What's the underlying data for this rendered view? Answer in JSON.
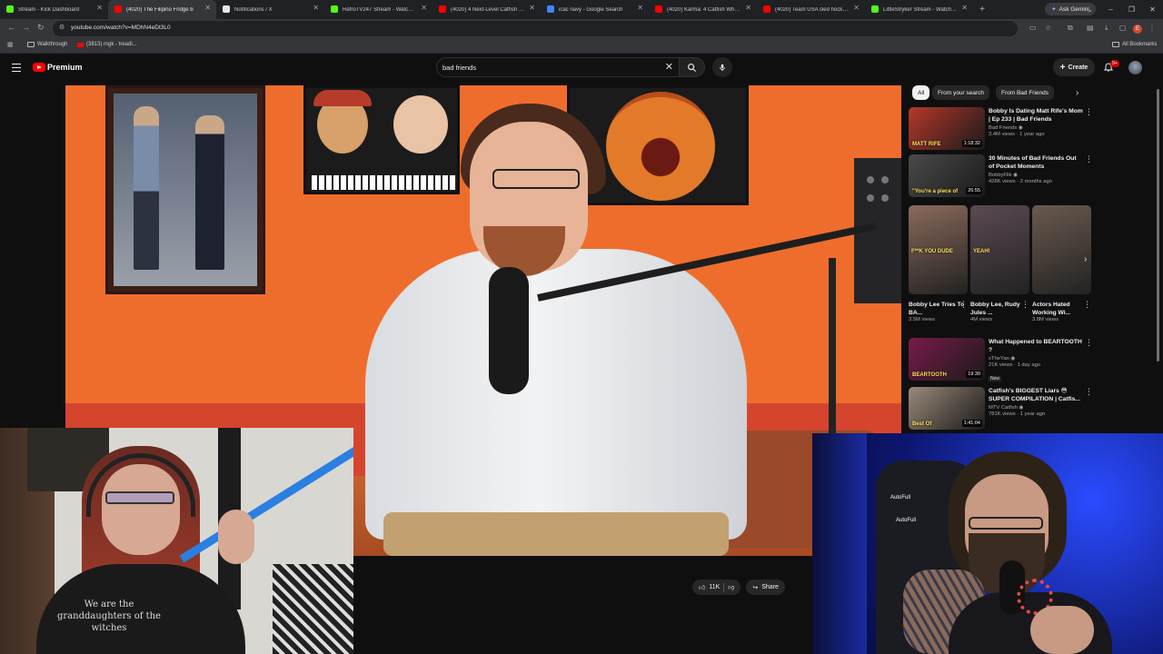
{
  "browser": {
    "tabs": [
      {
        "title": "Stream - Kick Dashboard",
        "favicon_color": "#53fc18",
        "active": false
      },
      {
        "title": "(4020) The Filipino Fridge b",
        "favicon_color": "#ff0000",
        "active": true
      },
      {
        "title": "Notifications / X",
        "favicon_color": "#e8e8e8",
        "active": false
      },
      {
        "title": "RetroTV247 Stream - Watch Li",
        "favicon_color": "#53fc18",
        "active": false
      },
      {
        "title": "(4020) 4 Next-Level Catfish Inv",
        "favicon_color": "#ff0000",
        "active": false
      },
      {
        "title": "icac navy - Google Search",
        "favicon_color": "#4285f4",
        "active": false
      },
      {
        "title": "(4020) Karma: 4 Catfish Who G",
        "favicon_color": "#ff0000",
        "active": false
      },
      {
        "title": "(4020) Team USA sled hockey o",
        "favicon_color": "#ff0000",
        "active": false
      },
      {
        "title": "LittleStryker Stream - Watch Li",
        "favicon_color": "#53fc18",
        "active": false
      }
    ],
    "new_tab": "+",
    "ask_gemini": "Ask Gemini",
    "address": "youtube.com/watch?v=MDhN4eDt3L0",
    "profile_initial": "E",
    "bookmarks": [
      {
        "label": "Walkthrough",
        "icon": "folder-icon"
      },
      {
        "label": "(3813) mgk - treadi...",
        "icon": "youtube-icon"
      }
    ],
    "all_bookmarks": "All Bookmarks"
  },
  "youtube": {
    "brand": "Premium",
    "search_query": "bad friends",
    "create_label": "Create",
    "notification_badge": "9+",
    "actions": {
      "likes": "11K",
      "share": "Share"
    },
    "chips": [
      {
        "label": "All",
        "selected": true
      },
      {
        "label": "From your search",
        "selected": false
      },
      {
        "label": "From Bad Friends",
        "selected": false
      }
    ],
    "recommendations_top": [
      {
        "title": "Bobby Is Dating Matt Rife's Mom | Ep 233 | Bad Friends",
        "channel": "Bad Friends",
        "views": "3.4M views · 1 year ago",
        "duration": "1:18:32",
        "thumb_text": "MATT RIFE",
        "thumb_color": "#b5382a"
      },
      {
        "title": "30 Minutes of Bad Friends Out of Pocket Moments",
        "channel": "BobbyFlik",
        "views": "428K views · 2 months ago",
        "duration": "26:55",
        "thumb_text": "\"You're a piece of",
        "thumb_color": "#4a4a4a"
      }
    ],
    "shorts": [
      {
        "title": "Bobby Lee Tries To BA...",
        "views": "3.5M views",
        "thumb_text": "F**K YOU DUDE",
        "thumb_color": "#8a6a5a"
      },
      {
        "title": "Bobby Lee, Rudy Jules ...",
        "views": "4M views",
        "thumb_text": "YEAH!",
        "thumb_color": "#5a4a52"
      },
      {
        "title": "Actors Hated Working Wi...",
        "views": "3.8M views",
        "thumb_text": "",
        "thumb_color": "#6a5a4e"
      }
    ],
    "recommendations_bottom": [
      {
        "title": "What Happened to BEARTOOTH ?",
        "channel": "xTheYan",
        "views": "21K views · 1 day ago",
        "badge": "New",
        "duration": "19:30",
        "thumb_text": "BEARTOOTH",
        "thumb_color": "#7a1a4a"
      },
      {
        "title": "Catfish's BIGGEST Liars 😳 SUPER COMPILATION | Catfis...",
        "channel": "MTV Catfish",
        "views": "781K views · 1 year ago",
        "badge": "",
        "duration": "1:41:04",
        "thumb_text": "Best Of",
        "thumb_color": "#9a8a7a"
      }
    ]
  },
  "webcams": {
    "left_shirt_text": "We are the granddaughters of the witches",
    "right_chair_brand": "AutoFull"
  }
}
